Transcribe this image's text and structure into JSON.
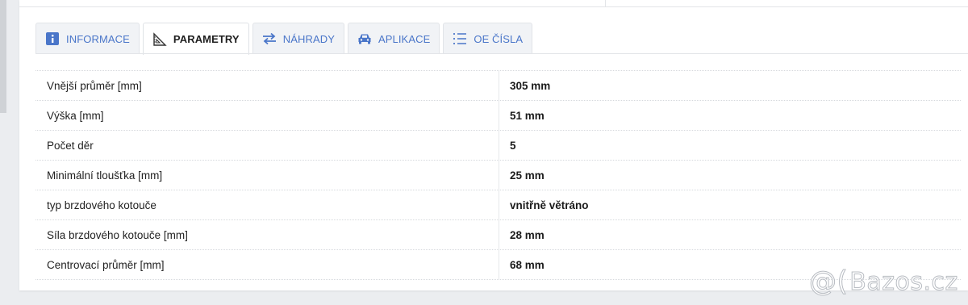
{
  "tabs": [
    {
      "label": "INFORMACE",
      "icon": "info-icon",
      "active": false
    },
    {
      "label": "PARAMETRY",
      "icon": "ruler-triangle-icon",
      "active": true
    },
    {
      "label": "NÁHRADY",
      "icon": "swap-arrows-icon",
      "active": false
    },
    {
      "label": "APLIKACE",
      "icon": "car-icon",
      "active": false
    },
    {
      "label": "OE ČÍSLA",
      "icon": "list-icon",
      "active": false
    }
  ],
  "parameters": [
    {
      "name": "Vnější průměr [mm]",
      "value": "305 mm"
    },
    {
      "name": "Výška [mm]",
      "value": "51 mm"
    },
    {
      "name": "Počet děr",
      "value": "5"
    },
    {
      "name": "Minimální tloušťka [mm]",
      "value": "25 mm"
    },
    {
      "name": "typ brzdového kotouče",
      "value": "vnitřně větráno"
    },
    {
      "name": "Síla brzdového kotouče [mm]",
      "value": "28 mm"
    },
    {
      "name": "Centrovací průměr [mm]",
      "value": "68 mm"
    }
  ],
  "watermark": {
    "symbol": "@(",
    "text": "Bazos.cz"
  },
  "colors": {
    "accent": "#4a76c9",
    "tab_bg": "#f1f3f6",
    "page_bg": "#ebedf0"
  }
}
